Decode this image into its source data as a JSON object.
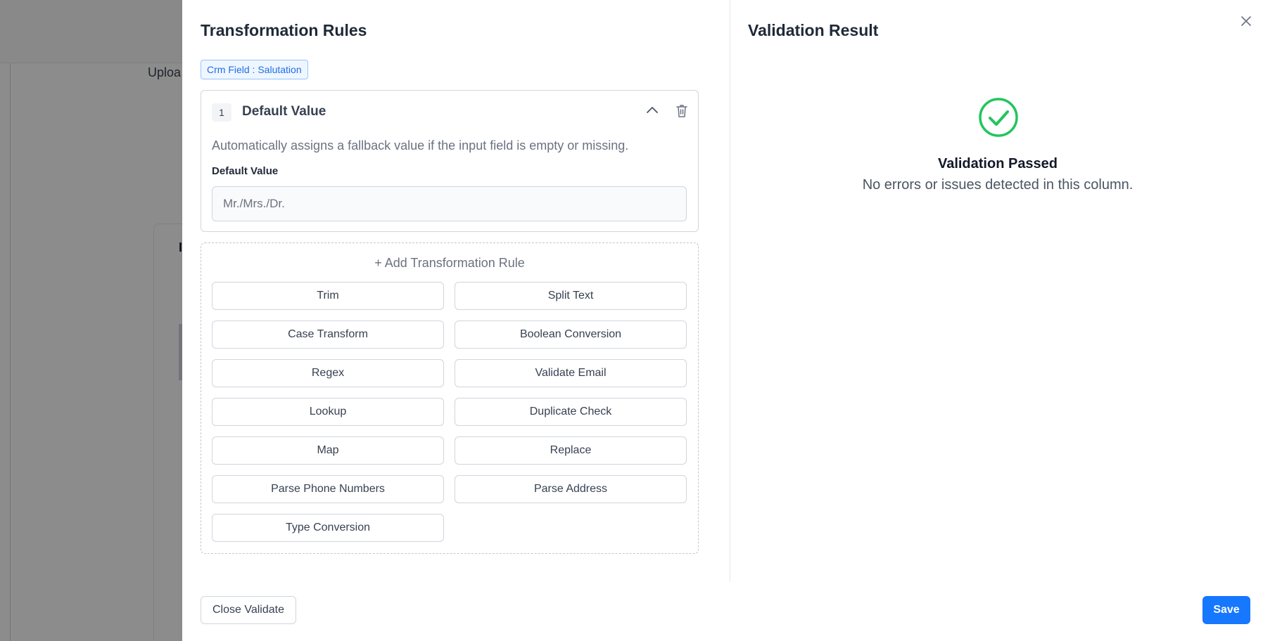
{
  "background": {
    "upload_label": "Uploa",
    "card_title": "I"
  },
  "left_panel": {
    "title": "Transformation Rules",
    "crm_tag": "Crm Field : Salutation",
    "rule": {
      "number": "1",
      "title": "Default Value",
      "description": "Automatically assigns a fallback value if the input field is empty or missing.",
      "field_label": "Default Value",
      "field_placeholder": "Mr./Mrs./Dr."
    },
    "add_rule_label": "+ Add Transformation Rule",
    "rule_options": [
      "Trim",
      "Split Text",
      "Case Transform",
      "Boolean Conversion",
      "Regex",
      "Validate Email",
      "Lookup",
      "Duplicate Check",
      "Map",
      "Replace",
      "Parse Phone Numbers",
      "Parse Address",
      "Type Conversion"
    ]
  },
  "right_panel": {
    "title": "Validation Result",
    "status_title": "Validation Passed",
    "status_desc": "No errors or issues detected in this column."
  },
  "footer": {
    "close_validate_label": "Close Validate",
    "save_label": "Save"
  },
  "colors": {
    "accent": "#1677ff",
    "success": "#22c55e",
    "tag_text": "#1d70e6"
  },
  "icons": {
    "close": "close-icon",
    "collapse": "chevron-up-icon",
    "delete": "trash-icon",
    "success": "check-circle-icon"
  }
}
